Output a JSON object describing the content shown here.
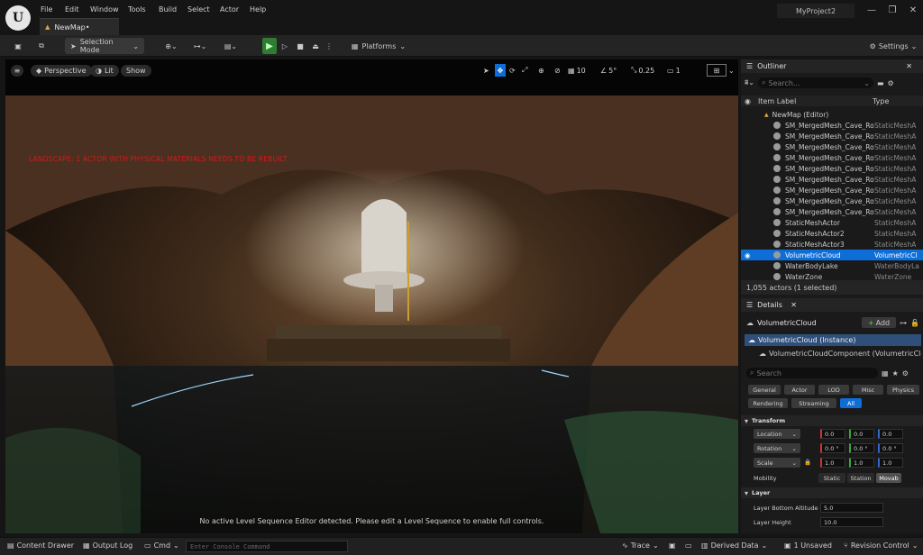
{
  "menu": [
    "File",
    "Edit",
    "Window",
    "Tools",
    "Build",
    "Select",
    "Actor",
    "Help"
  ],
  "tab_label": "NewMap•",
  "project_name": "MyProject2",
  "toolbar": {
    "selection_mode": "Selection Mode",
    "platforms": "Platforms",
    "settings": "Settings"
  },
  "viewport": {
    "perspective": "Perspective",
    "lit": "Lit",
    "show": "Show",
    "grid_snap": "10",
    "rot_snap": "5°",
    "scale_snap": "0.25",
    "cam_speed": "1",
    "warning": "LANDSCAPE: 1 ACTOR WITH PHYSICAL MATERIALS NEEDS TO BE REBUILT",
    "sequence_msg": "No active Level Sequence Editor detected. Please edit a Level Sequence to enable full controls."
  },
  "outliner": {
    "title": "Outliner",
    "search": "Search...",
    "col_label": "Item Label",
    "col_type": "Type",
    "map_root": "NewMap (Editor)",
    "rows": [
      {
        "label": "SM_MergedMesh_Cave_Ro",
        "type": "StaticMeshA"
      },
      {
        "label": "SM_MergedMesh_Cave_Ro",
        "type": "StaticMeshA"
      },
      {
        "label": "SM_MergedMesh_Cave_Ro",
        "type": "StaticMeshA"
      },
      {
        "label": "SM_MergedMesh_Cave_Ro",
        "type": "StaticMeshA"
      },
      {
        "label": "SM_MergedMesh_Cave_Ro",
        "type": "StaticMeshA"
      },
      {
        "label": "SM_MergedMesh_Cave_Ro",
        "type": "StaticMeshA"
      },
      {
        "label": "SM_MergedMesh_Cave_Ro",
        "type": "StaticMeshA"
      },
      {
        "label": "SM_MergedMesh_Cave_Ro",
        "type": "StaticMeshA"
      },
      {
        "label": "SM_MergedMesh_Cave_Ro",
        "type": "StaticMeshA"
      },
      {
        "label": "StaticMeshActor",
        "type": "StaticMeshA"
      },
      {
        "label": "StaticMeshActor2",
        "type": "StaticMeshA"
      },
      {
        "label": "StaticMeshActor3",
        "type": "StaticMeshA"
      },
      {
        "label": "VolumetricCloud",
        "type": "VolumetricCl",
        "selected": true
      },
      {
        "label": "WaterBodyLake",
        "type": "WaterBodyLa"
      },
      {
        "label": "WaterZone",
        "type": "WaterZone"
      }
    ],
    "footer": "1,055 actors (1 selected)"
  },
  "details": {
    "title": "Details",
    "actor": "VolumetricCloud",
    "add": "Add",
    "instance": "VolumetricCloud (Instance)",
    "component": "VolumetricCloudComponent (VolumetricCloud",
    "search": "Search",
    "chips1": [
      "General",
      "Actor",
      "LOD",
      "Misc",
      "Physics"
    ],
    "chips2": [
      "Rendering",
      "Streaming",
      "All"
    ],
    "transform": "Transform",
    "location": "Location",
    "rotation": "Rotation",
    "scale": "Scale",
    "loc_vals": [
      "0.0",
      "0.0",
      "0.0"
    ],
    "rot_vals": [
      "0.0 °",
      "0.0 °",
      "0.0 °"
    ],
    "scale_vals": [
      "1.0",
      "1.0",
      "1.0"
    ],
    "mobility": "Mobility",
    "mob_opts": [
      "Static",
      "Station",
      "Movab"
    ],
    "layer": "Layer",
    "layer_bottom": "Layer Bottom Altitude",
    "layer_bottom_val": "5.0",
    "layer_height": "Layer Height",
    "layer_height_val": "10.0"
  },
  "status": {
    "content_drawer": "Content Drawer",
    "output_log": "Output Log",
    "cmd": "Cmd",
    "console_ph": "Enter Console Command",
    "trace": "Trace",
    "derived_data": "Derived Data",
    "unsaved": "1 Unsaved",
    "revision": "Revision Control"
  }
}
